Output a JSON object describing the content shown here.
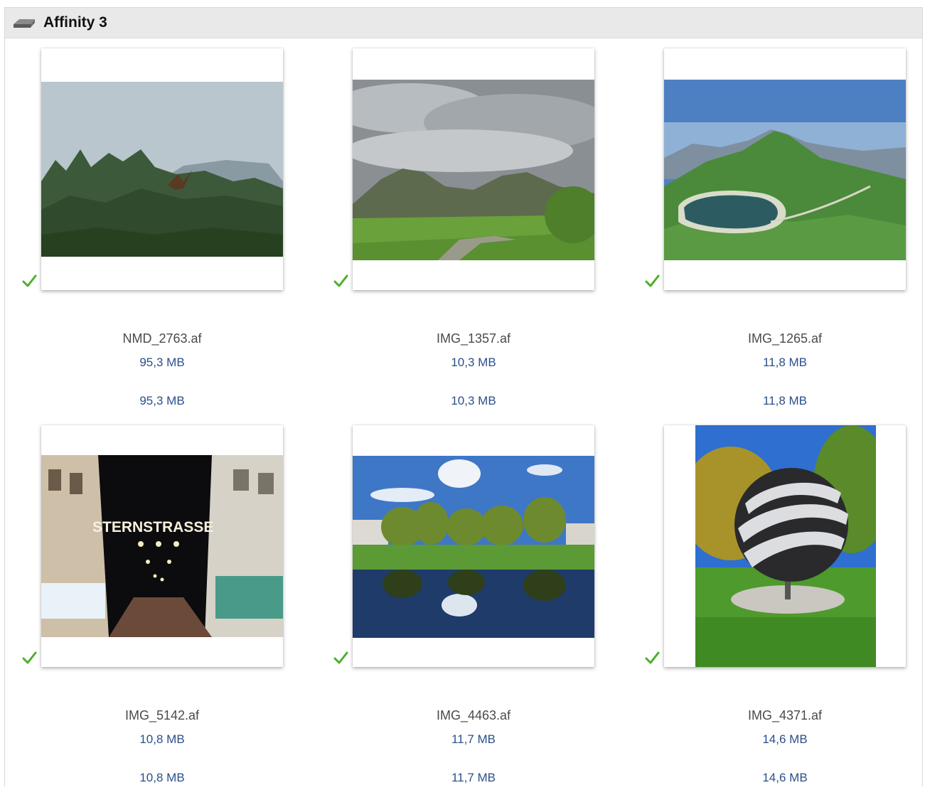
{
  "header": {
    "title": "Affinity 3",
    "icon": "drive-icon"
  },
  "items": [
    {
      "filename": "NMD_2763.af",
      "size": "95,3 MB",
      "size2": "95,3 MB",
      "checked": true,
      "check_color": "#4caf2a"
    },
    {
      "filename": "IMG_1357.af",
      "size": "10,3 MB",
      "size2": "10,3 MB",
      "checked": true,
      "check_color": "#4caf2a"
    },
    {
      "filename": "IMG_1265.af",
      "size": "11,8 MB",
      "size2": "11,8 MB",
      "checked": true,
      "check_color": "#4caf2a"
    },
    {
      "filename": "IMG_5142.af",
      "size": "10,8 MB",
      "size2": "10,8 MB",
      "checked": true,
      "check_color": "#4caf2a",
      "sign_text": "STERNSTRASSE"
    },
    {
      "filename": "IMG_4463.af",
      "size": "11,7 MB",
      "size2": "11,7 MB",
      "checked": true,
      "check_color": "#4caf2a"
    },
    {
      "filename": "IMG_4371.af",
      "size": "14,6 MB",
      "size2": "14,6 MB",
      "checked": true,
      "check_color": "#4caf2a"
    }
  ]
}
